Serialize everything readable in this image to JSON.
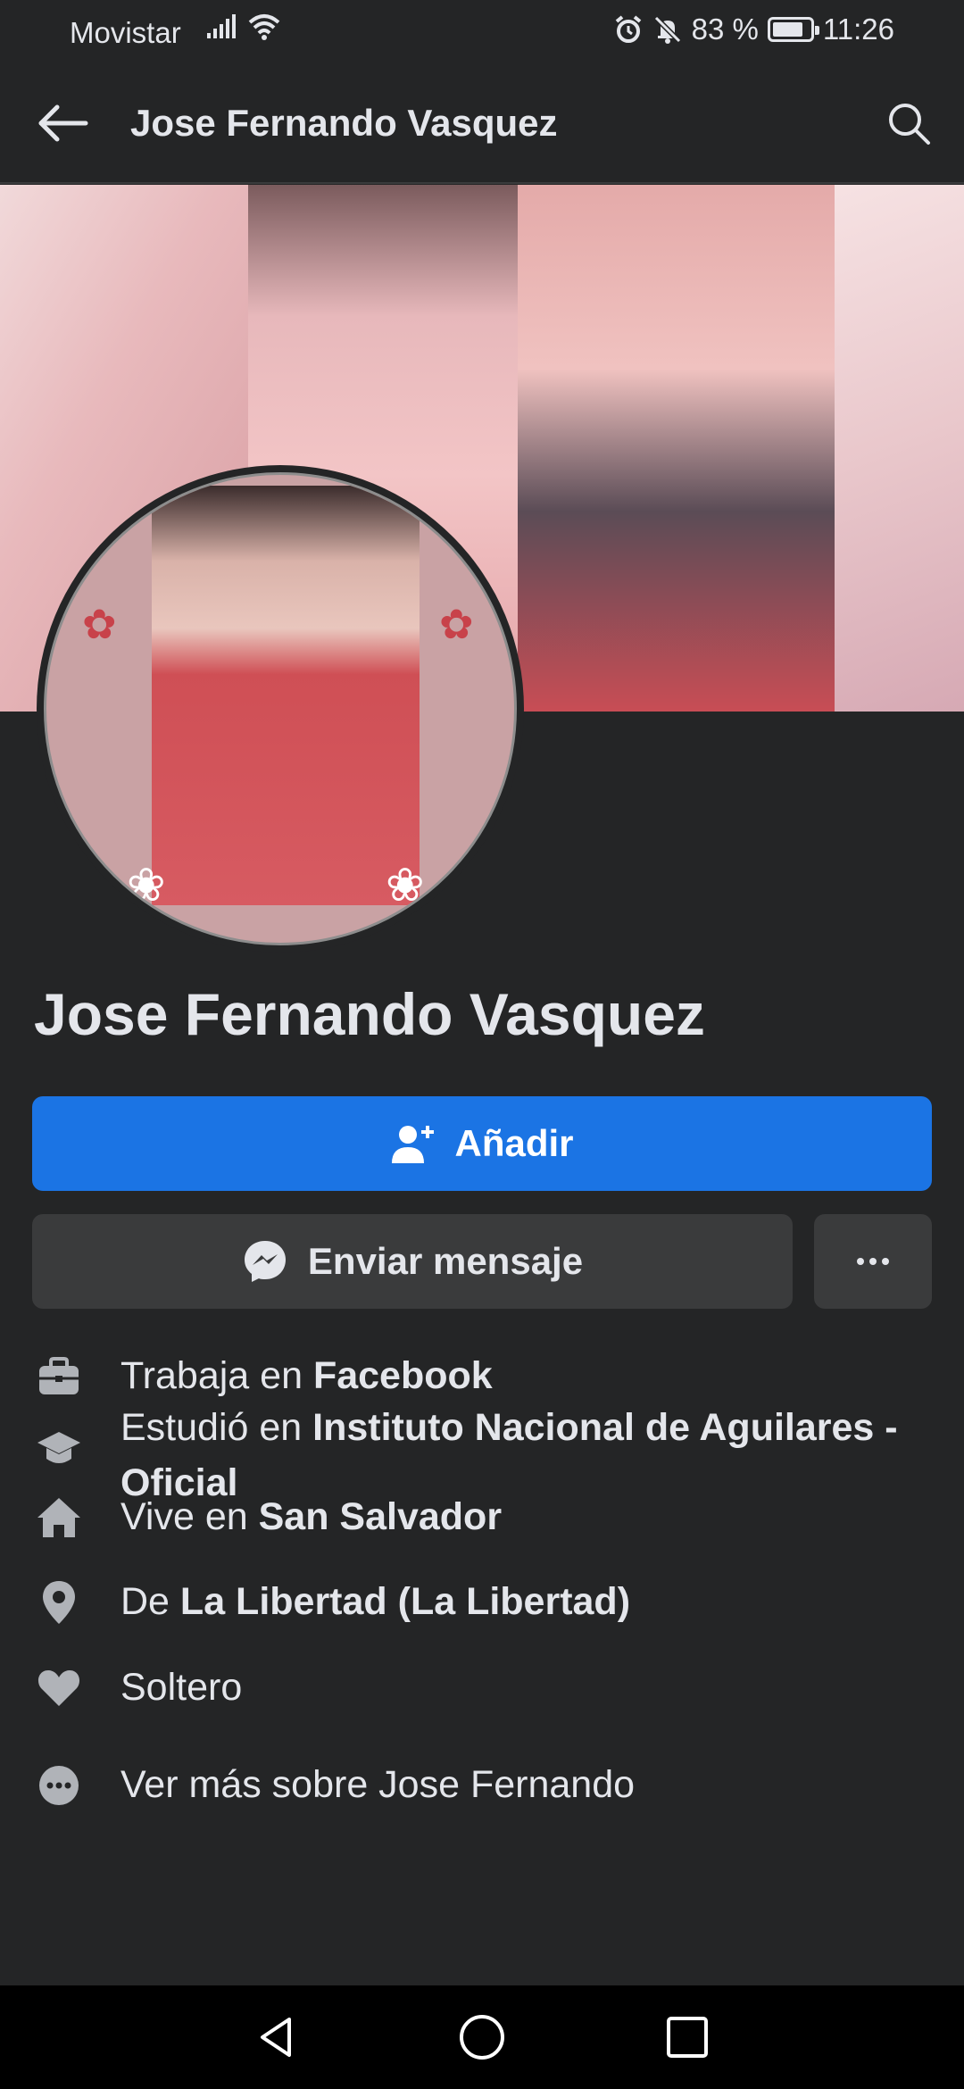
{
  "status_bar": {
    "carrier": "Movistar",
    "battery_percent": "83 %",
    "battery_level": 0.83,
    "time": "11:26"
  },
  "top_bar": {
    "title": "Jose Fernando Vasquez"
  },
  "profile": {
    "name": "Jose Fernando Vasquez"
  },
  "actions": {
    "add_label": "Añadir",
    "message_label": "Enviar mensaje"
  },
  "info": [
    {
      "icon": "briefcase-icon",
      "prefix": "Trabaja en ",
      "bold": "Facebook"
    },
    {
      "icon": "graduation-cap-icon",
      "prefix": "Estudió en ",
      "bold": "Instituto Nacional de Aguilares - Oficial"
    },
    {
      "icon": "home-icon",
      "prefix": "Vive en ",
      "bold": "San Salvador"
    },
    {
      "icon": "location-pin-icon",
      "prefix": "De ",
      "bold": "La Libertad (La Libertad)"
    },
    {
      "icon": "heart-icon",
      "prefix": "Soltero",
      "bold": ""
    },
    {
      "icon": "more-dots-icon",
      "prefix": "Ver más sobre Jose Fernando",
      "bold": ""
    }
  ],
  "colors": {
    "background": "#242526",
    "primary_button": "#1b74e4",
    "secondary_button": "#3a3b3c",
    "text": "#e4e6eb"
  }
}
